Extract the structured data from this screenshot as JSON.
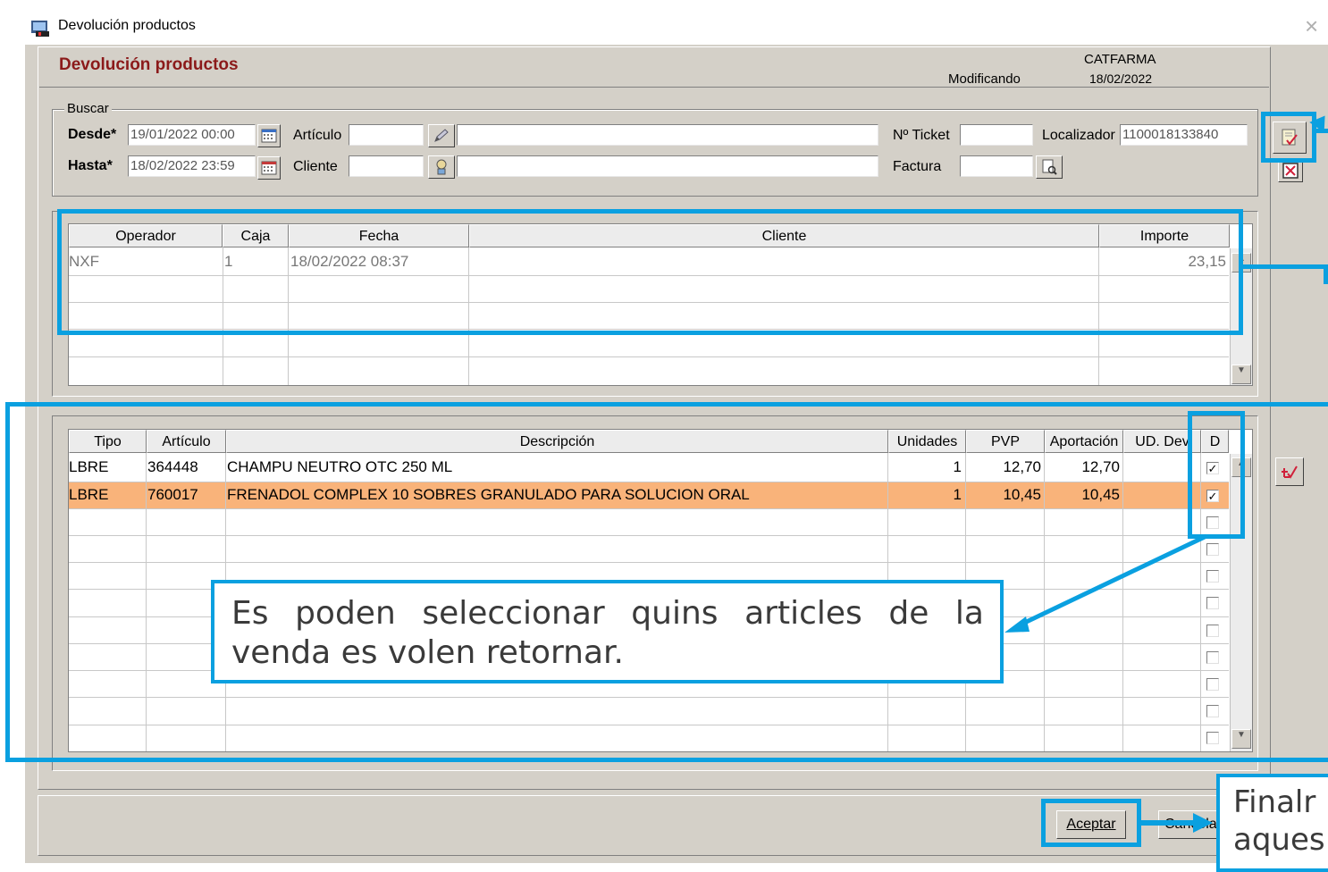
{
  "window": {
    "title": "Devolución productos",
    "close_glyph": "×"
  },
  "header": {
    "title": "Devolución productos",
    "mode": "Modificando",
    "company": "CATFARMA",
    "date": "18/02/2022",
    "title_color": "#8b0000"
  },
  "search": {
    "group_label": "Buscar",
    "desde_label": "Desde*",
    "desde_value": "19/01/2022 00:00",
    "hasta_label": "Hasta*",
    "hasta_value": "18/02/2022 23:59",
    "articulo_label": "Artículo",
    "articulo_code": "",
    "articulo_desc": "",
    "cliente_label": "Cliente",
    "cliente_code": "",
    "cliente_desc": "",
    "ticket_label": "Nº Ticket",
    "ticket_value": "",
    "localizador_label": "Localizador",
    "localizador_value": "1100018133840",
    "factura_label": "Factura",
    "factura_value": ""
  },
  "tickets": {
    "columns": [
      "Operador",
      "Caja",
      "Fecha",
      "Cliente",
      "Importe"
    ],
    "rows": [
      {
        "operador": "NXF",
        "caja": "1",
        "fecha": "18/02/2022 08:37",
        "cliente": "",
        "importe": "23,15"
      }
    ]
  },
  "lines": {
    "columns": [
      "Tipo",
      "Artículo",
      "Descripción",
      "Unidades",
      "PVP",
      "Aportación",
      "UD. Dev",
      "D"
    ],
    "rows": [
      {
        "tipo": "LBRE",
        "articulo": "364448",
        "descripcion": "CHAMPU NEUTRO OTC  250 ML",
        "unidades": "1",
        "pvp": "12,70",
        "aportacion": "12,70",
        "ud_dev": "",
        "checked": true
      },
      {
        "tipo": "LBRE",
        "articulo": "760017",
        "descripcion": "FRENADOL COMPLEX 10 SOBRES GRANULADO PARA SOLUCION ORAL",
        "unidades": "1",
        "pvp": "10,45",
        "aportacion": "10,45",
        "ud_dev": "",
        "checked": true
      }
    ],
    "selected_row_color": "#f9b37a"
  },
  "footer": {
    "accept_label": "Aceptar",
    "cancel_label": "Cancelar"
  },
  "annotations": {
    "callout_main": "Es poden seleccionar quins articles de la venda es volen retornar.",
    "callout_bottom_line1": "Finalr",
    "callout_bottom_line2": "aques",
    "accent_color": "#0aa0e0"
  },
  "icons": [
    "app-icon",
    "calendar-icon",
    "pencil-icon",
    "search-person-icon",
    "invoice-search-icon",
    "select-ticket-icon",
    "clear-icon",
    "return-check-icon",
    "checkbox-check-icon"
  ]
}
